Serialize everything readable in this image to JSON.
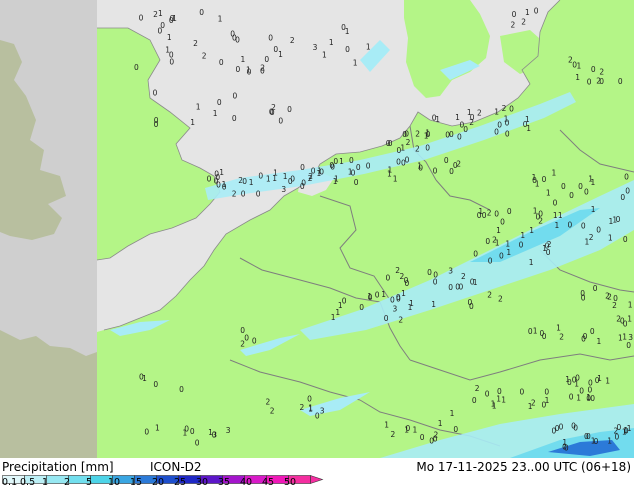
{
  "footer": {
    "title": "Precipitation [mm]",
    "product": "ICON-D2",
    "valid_time": "Mo 17-11-2025 23..00 UTC (06+18)"
  },
  "legend": {
    "levels": [
      "0.1",
      "0.5",
      "1",
      "2",
      "5",
      "10",
      "15",
      "20",
      "25",
      "30",
      "35",
      "40",
      "45",
      "50"
    ],
    "colors": [
      "#e1f8fb",
      "#bcf0f6",
      "#97e8f2",
      "#72dfee",
      "#4dd4e8",
      "#3aa6e2",
      "#2c7ad8",
      "#1e4fcd",
      "#1f28c6",
      "#5c16c9",
      "#a414cc",
      "#d81ac8",
      "#f018b8",
      "#f42ea0"
    ]
  },
  "map": {
    "colors": {
      "land": "#b4f587",
      "sea": "#e5e5e5",
      "outside_domain": "#cfcfcf",
      "borders": "#7e7e7e",
      "coast": "#8a8a8a",
      "precip_light": "#a8ecf6",
      "precip_medium": "#72dcee",
      "precip_heavy": "#2c7ad8"
    },
    "label_values": [
      "0",
      "1",
      "2",
      "3"
    ]
  }
}
